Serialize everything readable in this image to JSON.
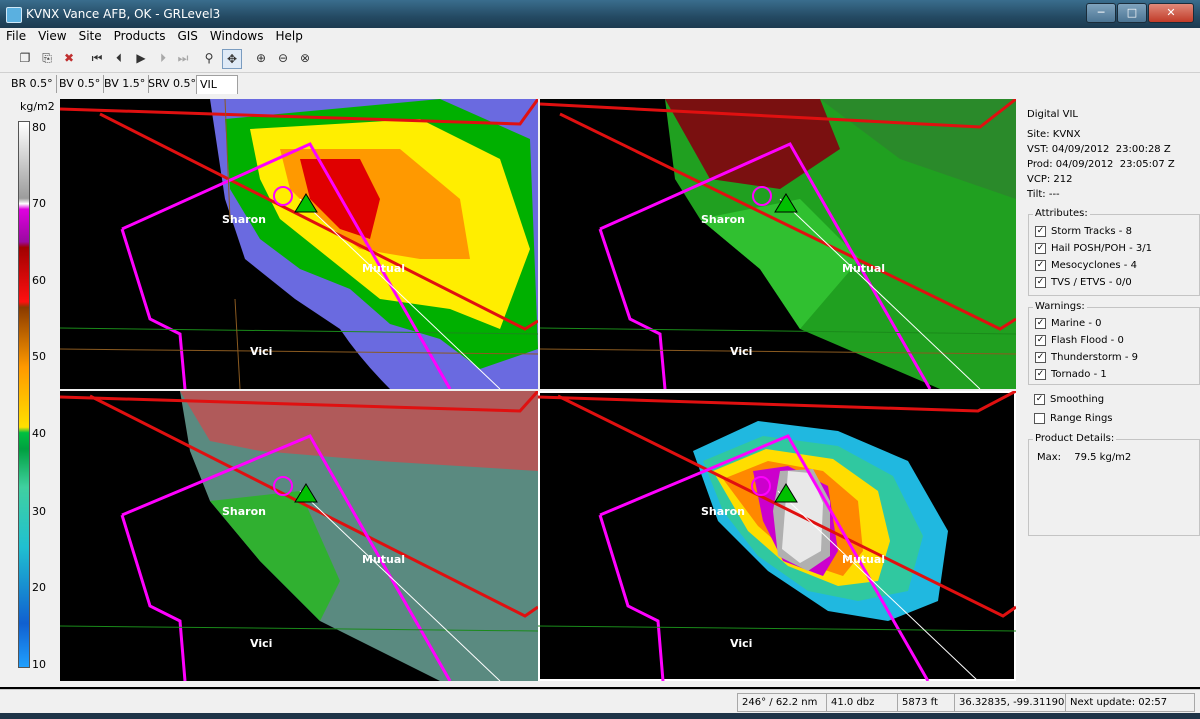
{
  "window": {
    "title": "KVNX Vance AFB, OK - GRLevel3",
    "minimize": "─",
    "maximize": "□",
    "close": "✕"
  },
  "menu": [
    "File",
    "View",
    "Site",
    "Products",
    "GIS",
    "Windows",
    "Help"
  ],
  "toolbar": {
    "icons": [
      "new-window",
      "copy",
      "delete",
      "first-frame",
      "step-back",
      "play",
      "step-forward",
      "last-frame",
      "zoom",
      "pan",
      "zoom-in",
      "zoom-out",
      "zoom-reset"
    ]
  },
  "tabs": [
    "BR 0.5°",
    "BV 0.5°",
    "BV 1.5°",
    "SRV 0.5°",
    "VIL"
  ],
  "colorbar": {
    "unit": "kg/m2",
    "labels": [
      "80",
      "70",
      "60",
      "50",
      "40",
      "30",
      "20",
      "10"
    ]
  },
  "map_labels": {
    "sharon": "Sharon",
    "mutual": "Mutual",
    "vici": "Vici"
  },
  "info": {
    "title": "Digital VIL",
    "site_label": "Site:",
    "site": "KVNX",
    "vst_label": "VST:",
    "vst": "04/09/2012  23:00:28 Z",
    "prod_label": "Prod:",
    "prod": "04/09/2012  23:05:07 Z",
    "vcp_label": "VCP:",
    "vcp": "212",
    "tilt_label": "Tilt:",
    "tilt": "---"
  },
  "attributes": {
    "label": "Attributes:",
    "items": [
      "Storm Tracks - 8",
      "Hail POSH/POH - 3/1",
      "Mesocyclones - 4",
      "TVS / ETVS - 0/0"
    ]
  },
  "warnings": {
    "label": "Warnings:",
    "items": [
      "Marine - 0",
      "Flash Flood - 0",
      "Thunderstorm - 9",
      "Tornado - 1"
    ]
  },
  "options": {
    "smoothing": "Smoothing",
    "range_rings": "Range Rings"
  },
  "details": {
    "label": "Product Details:",
    "max_label": "Max:",
    "max_value": "79.5 kg/m2"
  },
  "status": [
    "246° / 62.2 nm",
    "41.0 dbz",
    "5873 ft",
    "36.32835, -99.31190",
    "Next update: 02:57"
  ]
}
